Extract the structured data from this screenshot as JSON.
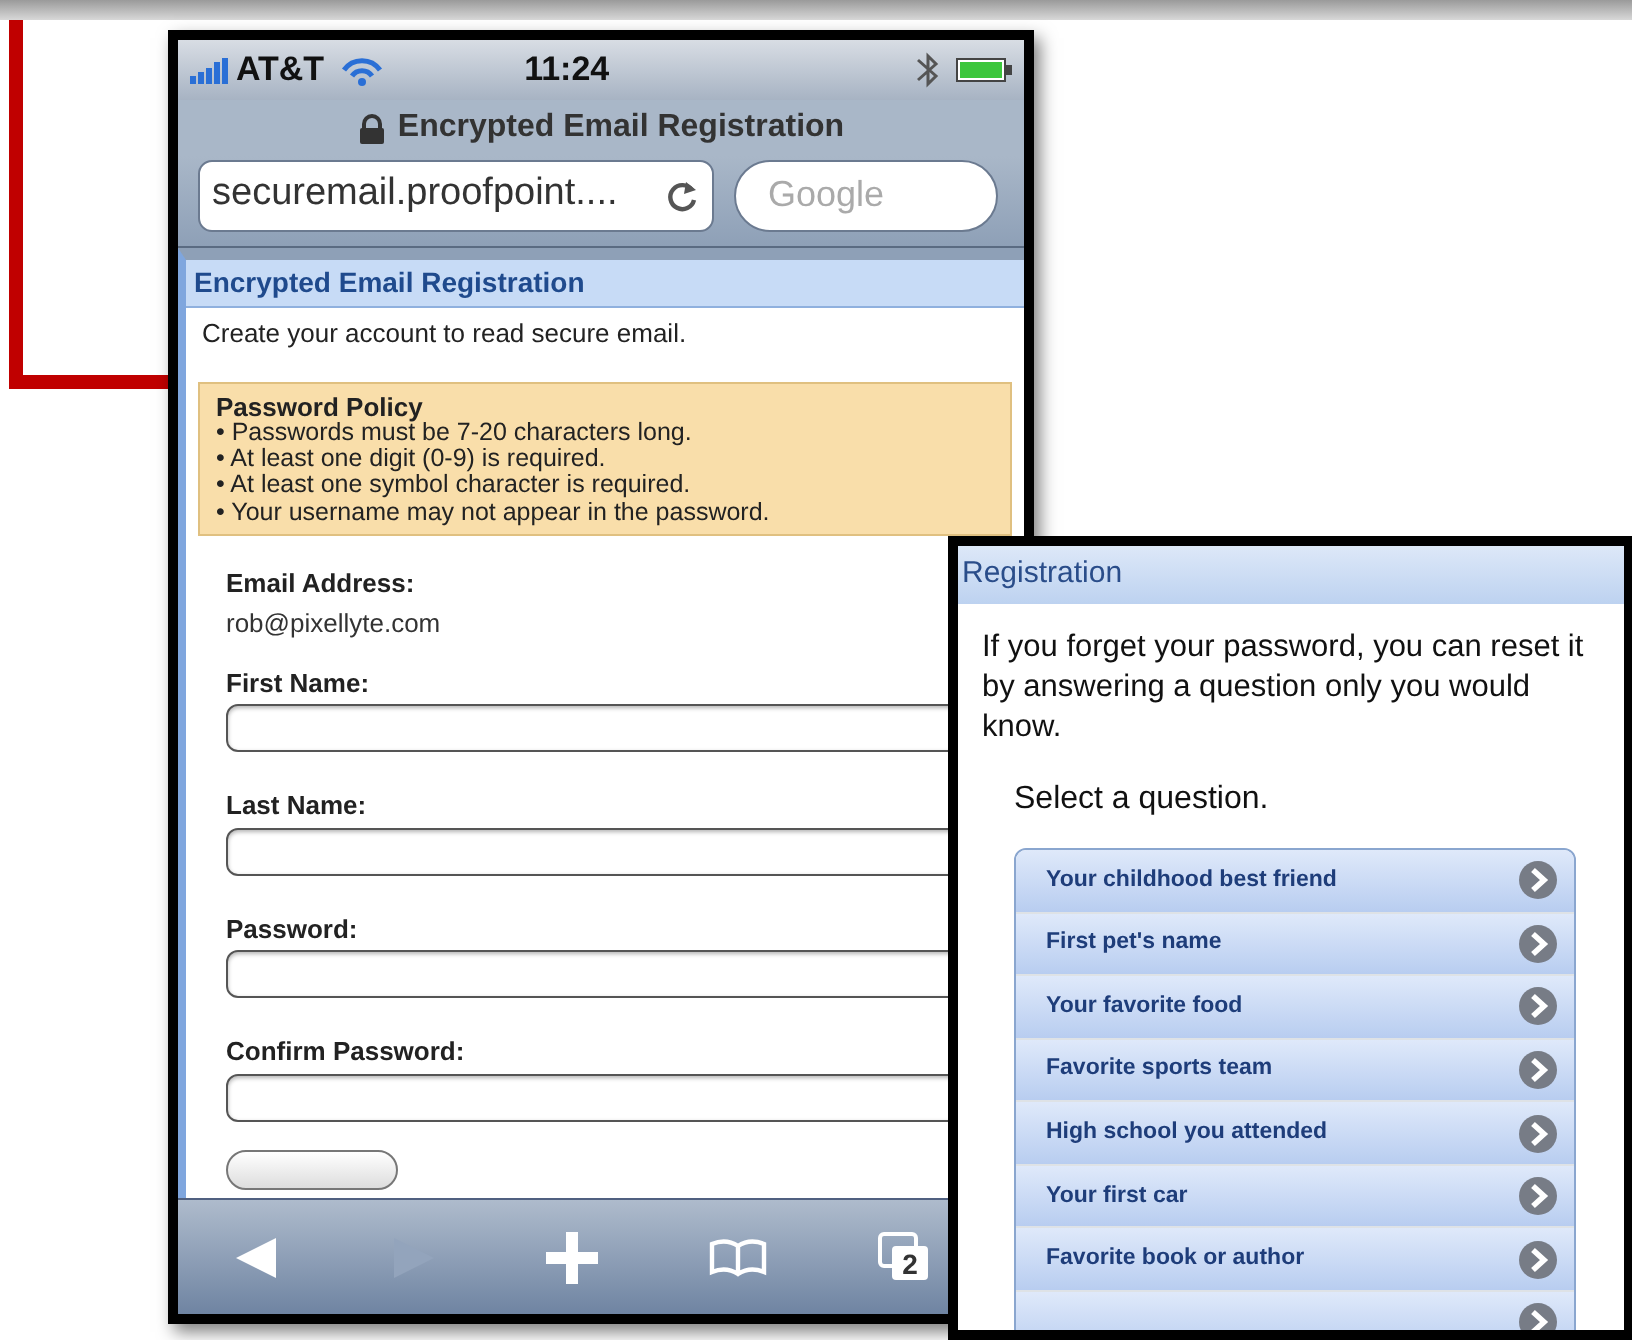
{
  "status_bar": {
    "carrier": "AT&T",
    "time": "11:24"
  },
  "browser": {
    "title": "Encrypted Email Registration",
    "url": "securemail.proofpoint....",
    "search_placeholder": "Google"
  },
  "page": {
    "header": "Encrypted Email Registration",
    "intro": "Create your account to read secure email.",
    "policy": {
      "title": "Password Policy",
      "items": [
        "• Passwords must be 7-20 characters long.",
        "• At least one digit (0-9) is required.",
        "• At least one symbol character is required.",
        "• Your username may not appear in the password."
      ]
    },
    "email": {
      "label": "Email Address:",
      "value": "rob@pixellyte.com"
    },
    "fields": [
      {
        "label": "First Name:"
      },
      {
        "label": "Last Name:"
      },
      {
        "label": "Password:"
      },
      {
        "label": "Confirm Password:"
      }
    ]
  },
  "toolbar": [
    {
      "kind": "back",
      "disabled": false
    },
    {
      "kind": "forward",
      "disabled": true
    },
    {
      "kind": "add",
      "disabled": false
    },
    {
      "kind": "bookmarks",
      "disabled": false
    },
    {
      "kind": "pages",
      "disabled": false,
      "count": "2"
    }
  ],
  "overlay": {
    "header": "Registration",
    "text": "If you forget your password, you can reset it by answering a question only you would know.",
    "prompt": "Select a question.",
    "questions": [
      "Your childhood best friend",
      "First pet's name",
      "Your favorite food",
      "Favorite sports team",
      "High school you attended",
      "Your first car",
      "Favorite book or author"
    ]
  }
}
